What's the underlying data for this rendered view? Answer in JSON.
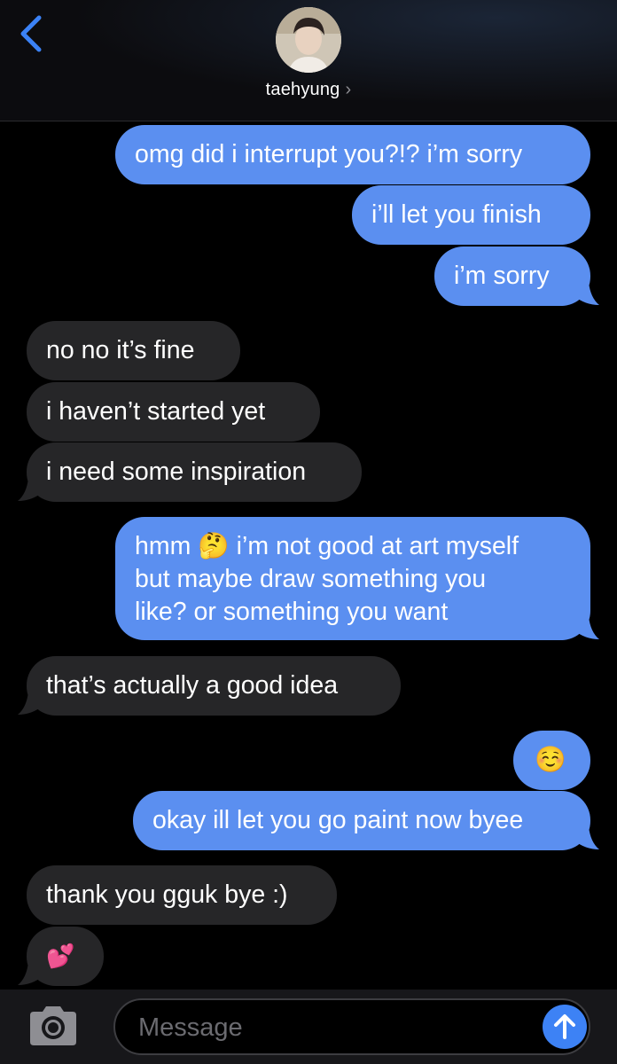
{
  "header": {
    "contact_name": "taehyung",
    "chevron": "›",
    "back_icon": "chevron-left-icon"
  },
  "messages": [
    {
      "from": "me",
      "text": "omg did i interrupt you?!? i’m sorry"
    },
    {
      "from": "me",
      "text": "i’ll let you finish"
    },
    {
      "from": "me",
      "text": "i’m sorry"
    },
    {
      "from": "them",
      "text": "no no it’s fine"
    },
    {
      "from": "them",
      "text": "i haven’t started yet"
    },
    {
      "from": "them",
      "text": "i need some inspiration"
    },
    {
      "from": "me",
      "text_line1": "hmm 🤔 i’m not good at art myself",
      "text_line2": "but maybe draw something you",
      "text_line3": "like? or something you want"
    },
    {
      "from": "them",
      "text": "that’s actually a good idea"
    },
    {
      "from": "me",
      "text": "☺️"
    },
    {
      "from": "me",
      "text": "okay ill let you go paint now byee"
    },
    {
      "from": "them",
      "text": "thank you gguk bye :)"
    },
    {
      "from": "them",
      "text": "💕"
    }
  ],
  "composer": {
    "placeholder": "Message",
    "camera_icon": "camera-icon",
    "send_icon": "arrow-up-icon"
  },
  "colors": {
    "sent_bubble": "#5b8ff0",
    "received_bubble": "#262628",
    "background": "#000000",
    "accent": "#3d82f5"
  }
}
